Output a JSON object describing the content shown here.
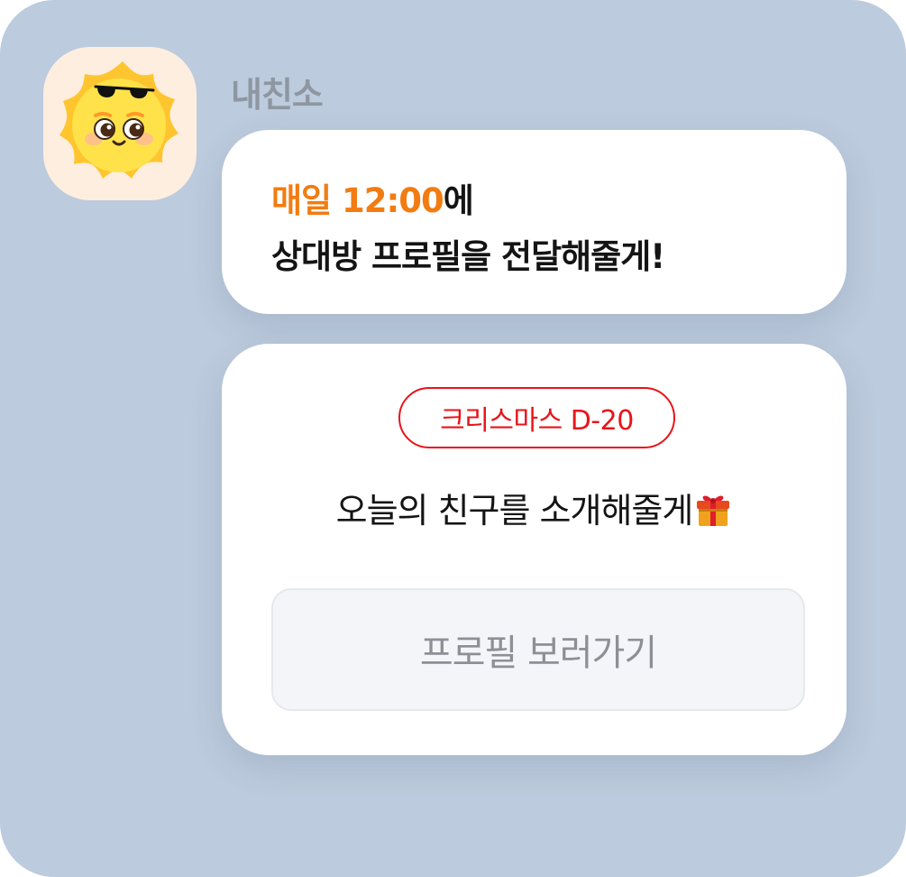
{
  "sender": {
    "name": "내친소",
    "avatar_icon": "sun-with-sunglasses-icon"
  },
  "message_1": {
    "highlight": "매일 12:00",
    "line1_suffix": "에",
    "line2": "상대방 프로필을 전달해줄게!"
  },
  "message_2": {
    "badge": "크리스마스 D-20",
    "intro_text": "오늘의 친구를 소개해줄게",
    "intro_icon": "gift-icon",
    "button_label": "프로필 보러가기"
  },
  "colors": {
    "background": "#bccbdd",
    "highlight": "#f27c12",
    "badge": "#e8141a",
    "button_bg": "#f4f5f8",
    "button_text": "#8c9096",
    "name_text": "#8e97a1"
  }
}
